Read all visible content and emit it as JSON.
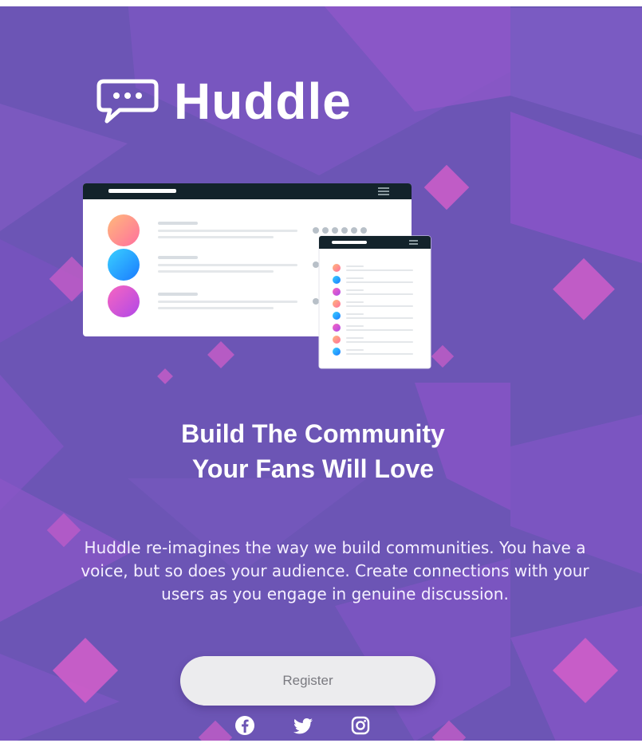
{
  "brand": {
    "name": "Huddle",
    "logo_icon": "chat-bubble-icon"
  },
  "hero": {
    "headline_line1": "Build The Community",
    "headline_line2": "Your Fans Will Love",
    "description": "Huddle re-imagines the way we build communities. You have a voice, but so does your audience. Create connections with your users as you engage in genuine discussion."
  },
  "cta": {
    "register_label": "Register"
  },
  "social": {
    "icons": [
      "facebook-icon",
      "twitter-icon",
      "instagram-icon"
    ]
  },
  "colors": {
    "background": "#6c55b5",
    "accent_pink": "#ce5ccc",
    "button_bg": "#ececee",
    "mockup_header": "#13232b"
  }
}
